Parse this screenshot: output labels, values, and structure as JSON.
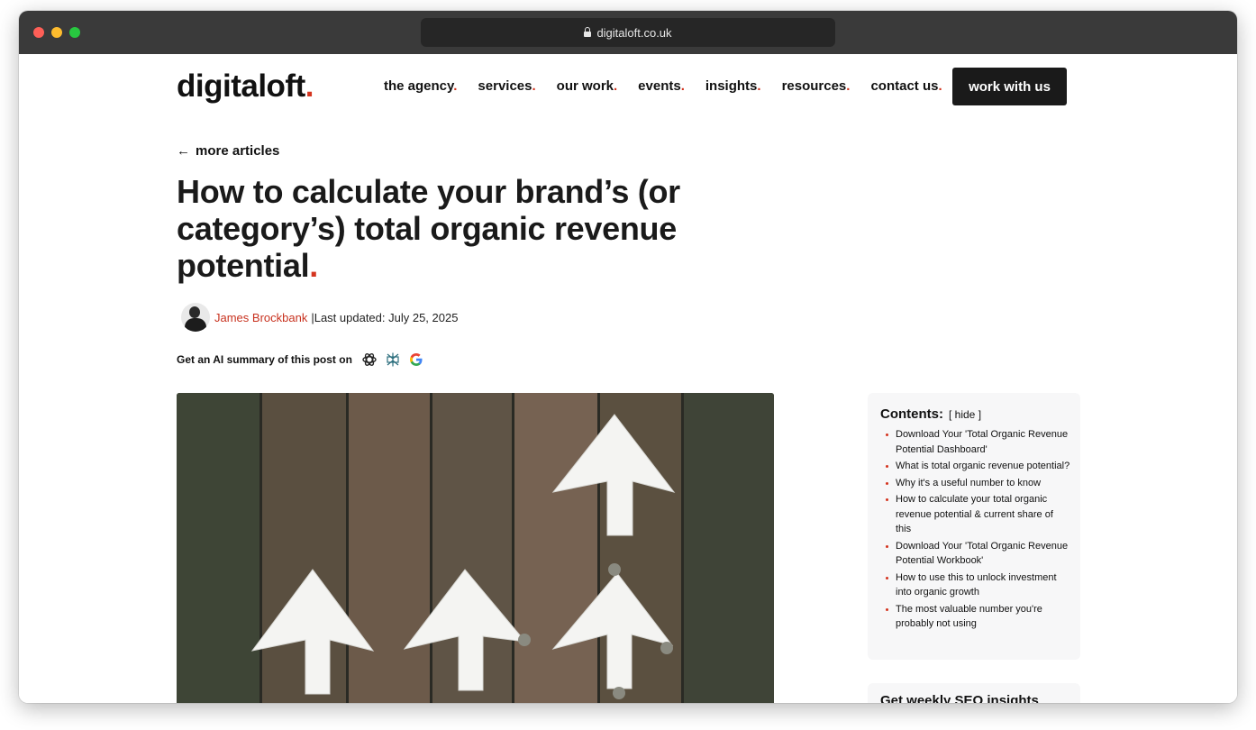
{
  "browser": {
    "url": "digitaloft.co.uk"
  },
  "brand": {
    "logo_text": "digitaloft",
    "logo_dot": ".",
    "accent_color": "#d4341f"
  },
  "nav": {
    "items": [
      {
        "label": "the agency",
        "dot": "."
      },
      {
        "label": "services",
        "dot": "."
      },
      {
        "label": "our work",
        "dot": "."
      },
      {
        "label": "events",
        "dot": "."
      },
      {
        "label": "insights",
        "dot": "."
      },
      {
        "label": "resources",
        "dot": "."
      },
      {
        "label": "contact us",
        "dot": "."
      }
    ],
    "cta_label": "work with us"
  },
  "article": {
    "back_arrow": "←",
    "back_label": "more articles",
    "title_line1": "How to calculate your brand’s (or",
    "title_line2": "category’s) total organic revenue",
    "title_line3": "potential",
    "title_dot": ".",
    "author": "James Brockbank",
    "separator": " | ",
    "last_updated": "Last updated: July 25, 2025",
    "ai_summary_label": "Get an AI summary of this post on",
    "ai_icons": [
      "chatgpt-icon",
      "perplexity-icon",
      "google-icon"
    ]
  },
  "toc": {
    "heading": "Contents:",
    "hide_label": "[ hide ]",
    "items": [
      "Download Your 'Total Organic Revenue Potential Dashboard'",
      "What is total organic revenue potential?",
      "Why it's a useful number to know",
      "How to calculate your total organic revenue potential & current share of this",
      "Download Your 'Total Organic Revenue Potential Workbook'",
      "How to use this to unlock investment into organic growth",
      "The most valuable number you're probably not using"
    ]
  },
  "newsletter": {
    "title": "Get weekly SEO insights"
  }
}
